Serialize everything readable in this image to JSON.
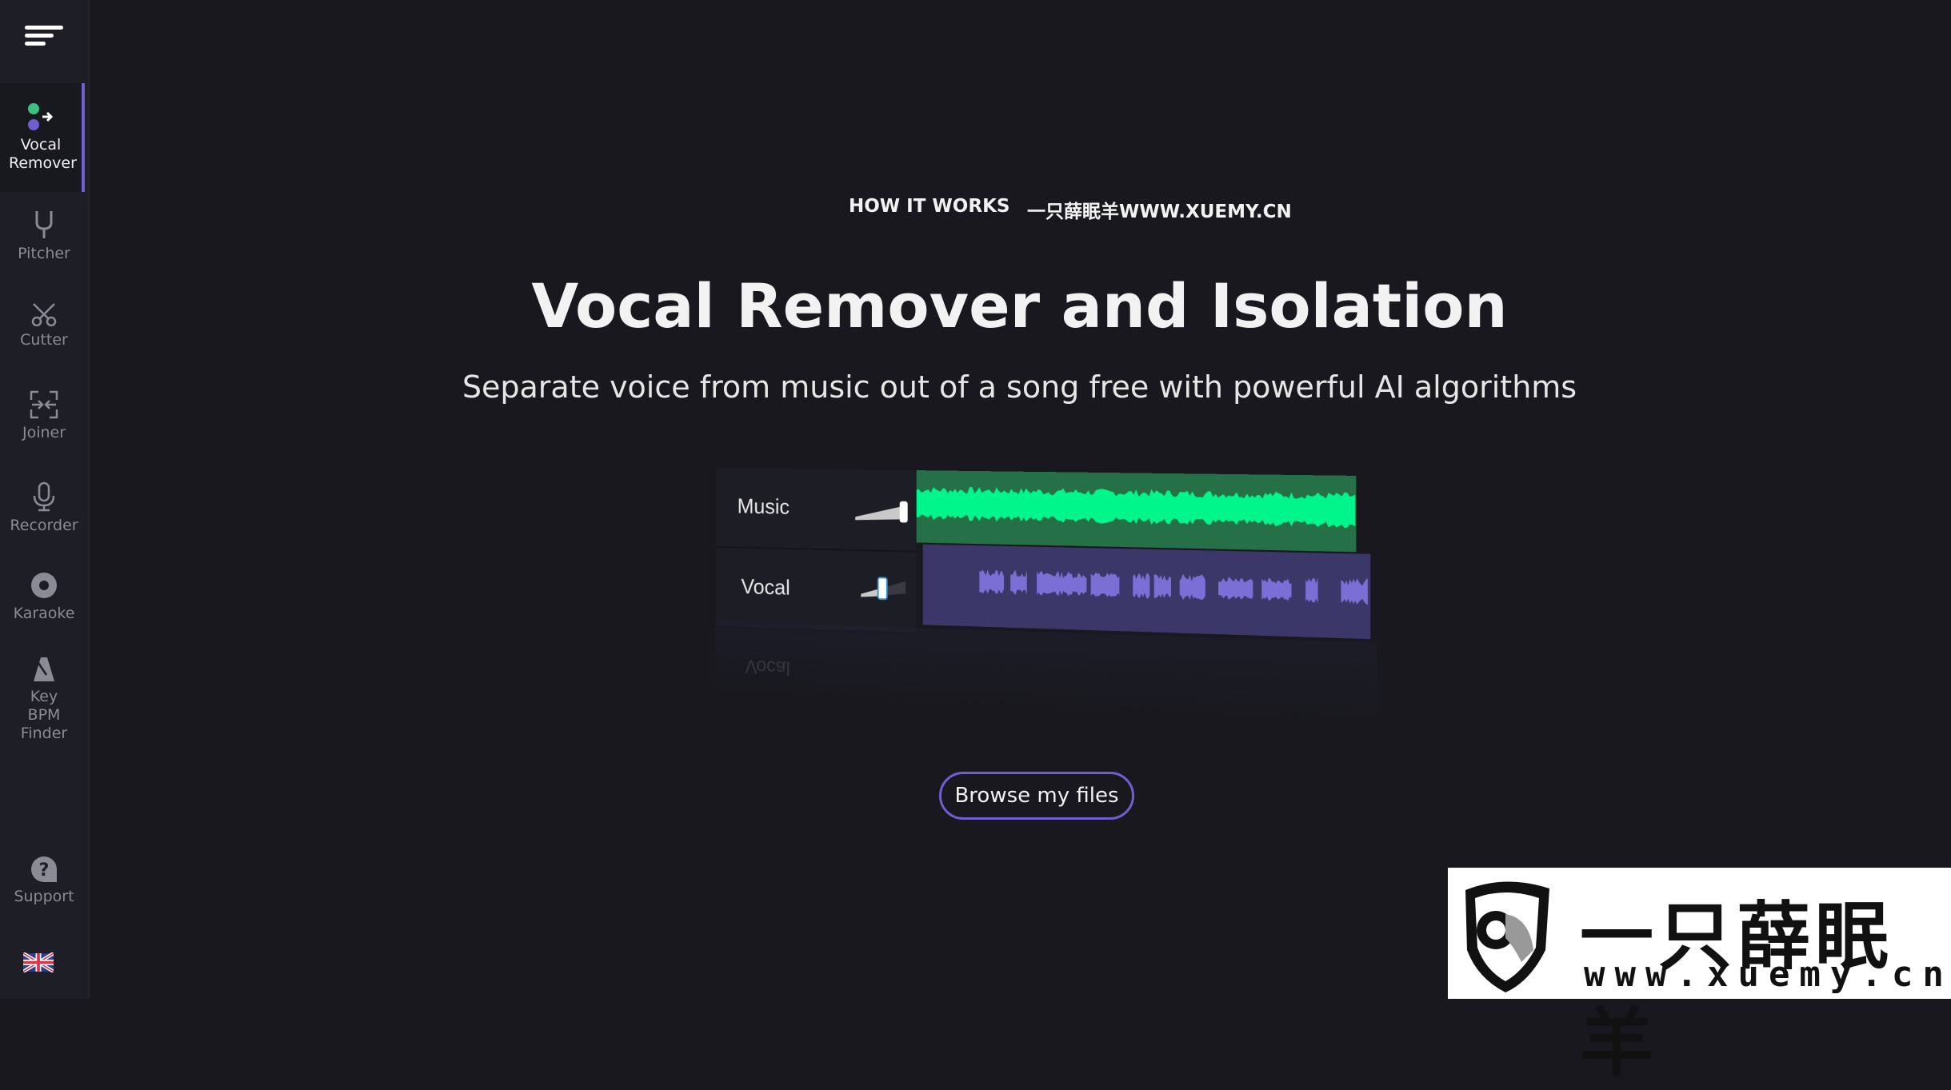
{
  "sidebar": {
    "menu_icon": "hamburger-menu-icon",
    "items": [
      {
        "label": "Vocal Remover",
        "icon": "vocal-remover-icon",
        "active": true
      },
      {
        "label": "Pitcher",
        "icon": "tuning-fork-icon",
        "active": false
      },
      {
        "label": "Cutter",
        "icon": "scissors-icon",
        "active": false
      },
      {
        "label": "Joiner",
        "icon": "joiner-icon",
        "active": false
      },
      {
        "label": "Recorder",
        "icon": "microphone-icon",
        "active": false
      },
      {
        "label": "Karaoke",
        "icon": "disc-icon",
        "active": false
      },
      {
        "label": "Key BPM Finder",
        "icon": "metronome-icon",
        "active": false
      }
    ],
    "support": {
      "label": "Support",
      "icon": "help-icon"
    },
    "language": {
      "icon": "uk-flag-icon",
      "value": "English (UK)"
    }
  },
  "topnav": {
    "links": [
      "HOW IT WORKS",
      "一只薛眠羊WWW.XUEMY.CN"
    ]
  },
  "hero": {
    "title": "Vocal Remover and Isolation",
    "subtitle": "Separate voice from music out of a song free with powerful AI algorithms"
  },
  "illustration": {
    "tracks": [
      {
        "name": "Music",
        "volume": 1.0,
        "color": "#00f58a",
        "bg": "#267047"
      },
      {
        "name": "Vocal",
        "volume": 0.35,
        "color": "#7b6fd6",
        "bg": "#3b3768"
      }
    ],
    "reflection_label": "Vocal"
  },
  "cta": {
    "browse_label": "Browse my files"
  },
  "watermark": {
    "cn": "一只薛眠羊",
    "url": "www.xuemy.cn"
  },
  "colors": {
    "accent": "#6d5fcf",
    "bg": "#18181e",
    "sidebar_bg": "#1e1e27",
    "green": "#3dbf7f"
  }
}
